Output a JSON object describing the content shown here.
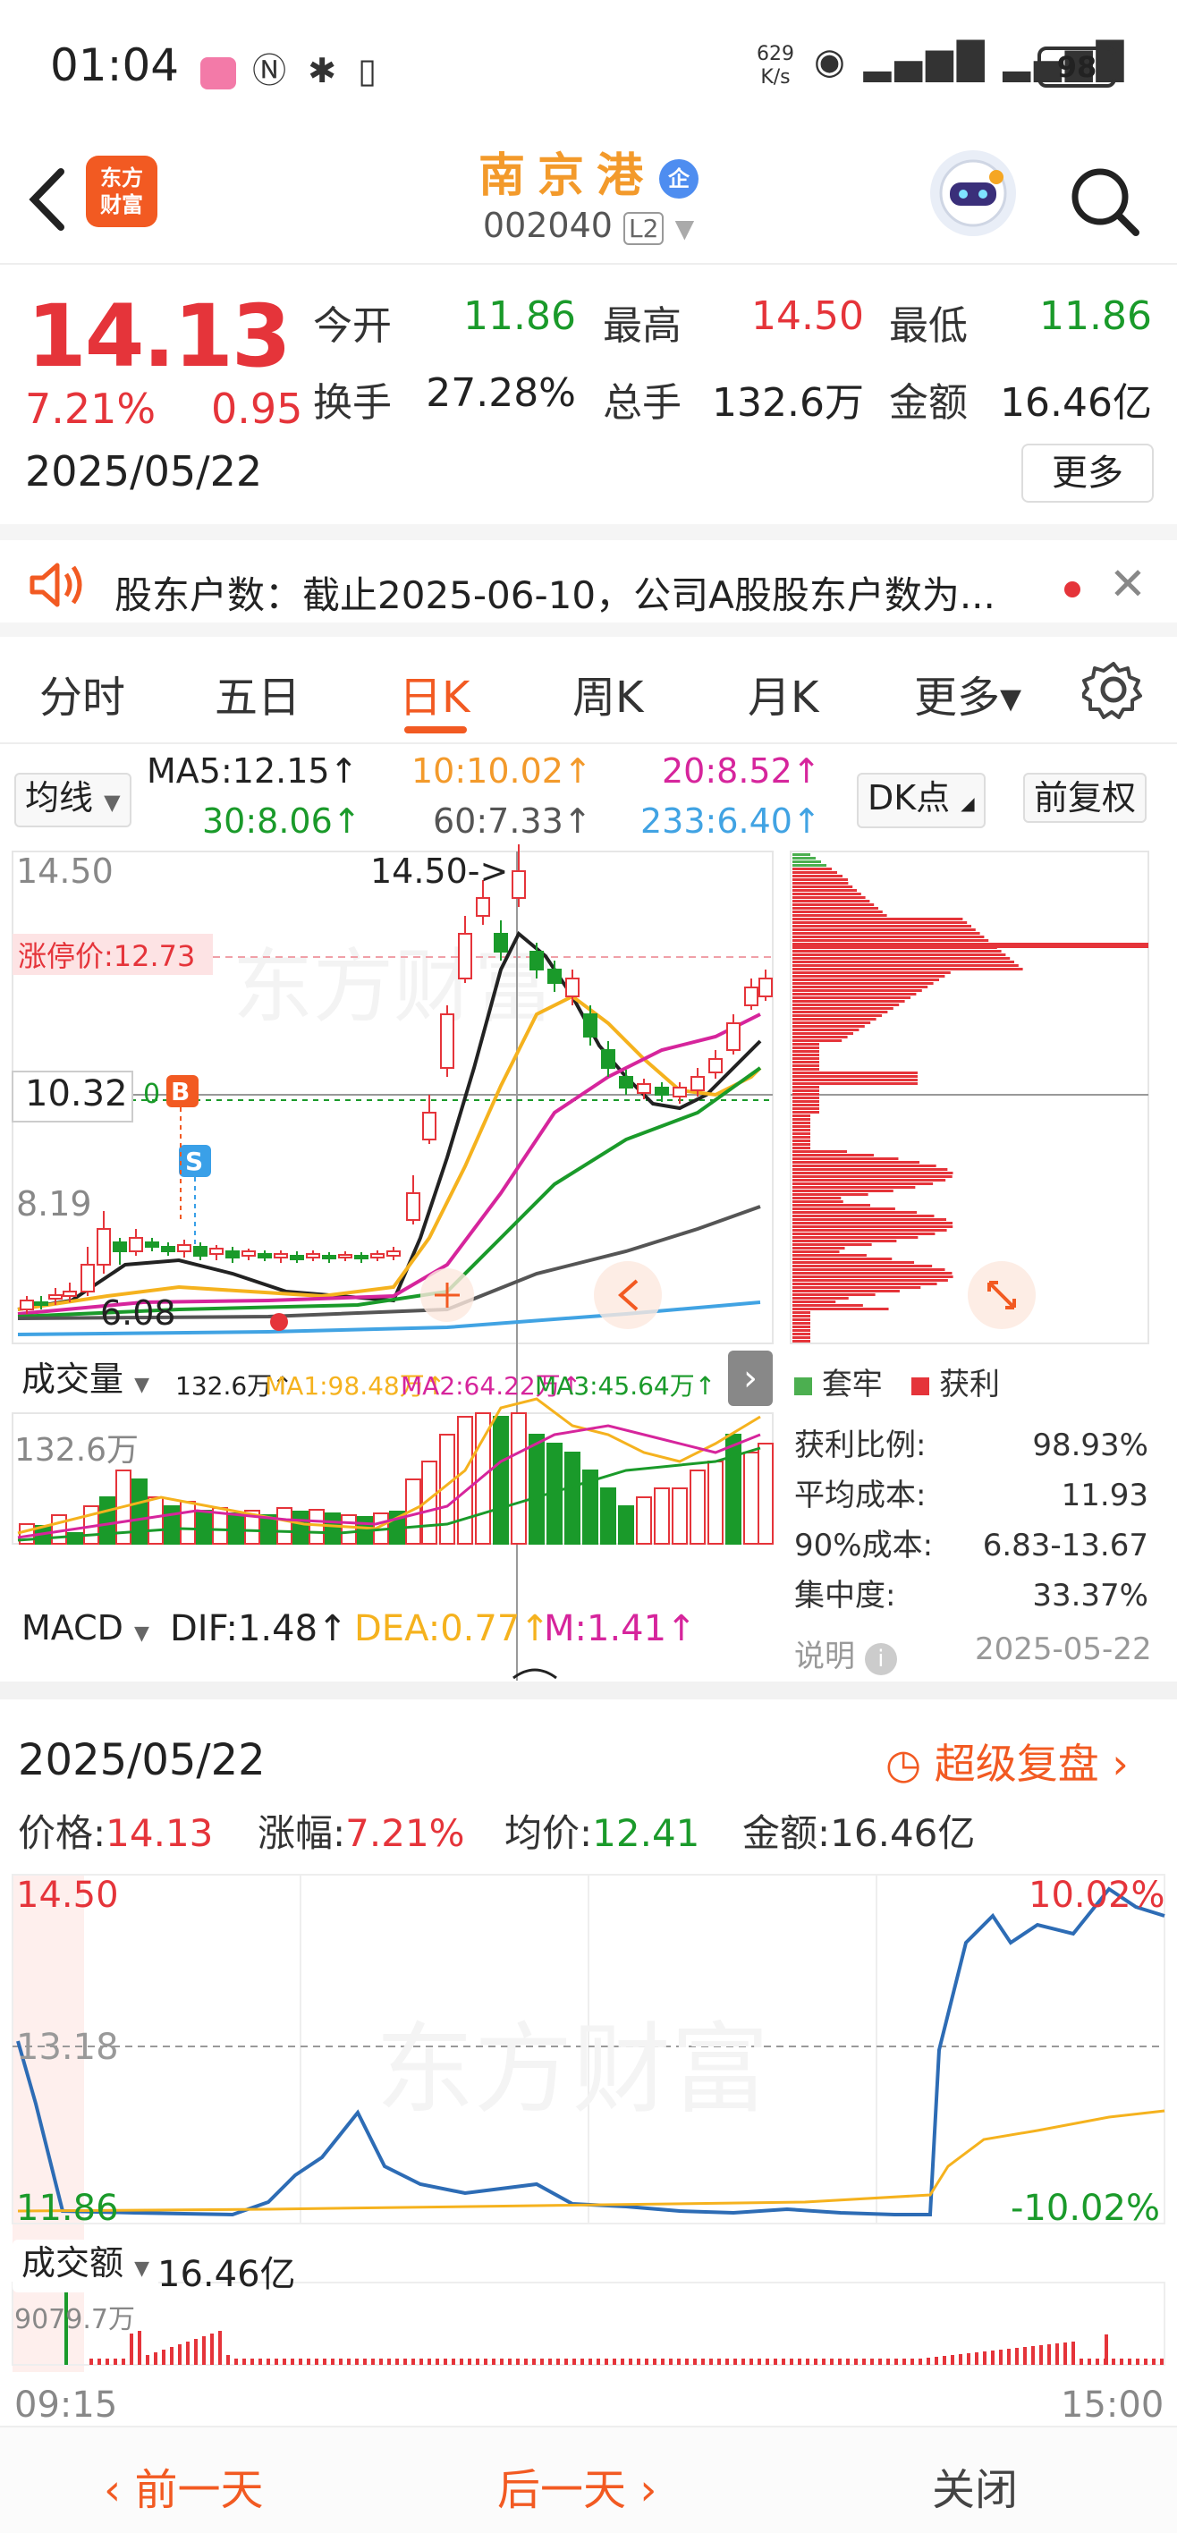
{
  "status_bar": {
    "time": "01:04",
    "net_speed_value": "629",
    "net_speed_unit": "K/s",
    "battery": "98"
  },
  "header": {
    "logo_line1": "东方",
    "logo_line2": "财富",
    "stock_name": "南京港",
    "badge": "企",
    "stock_code": "002040",
    "level": "L2"
  },
  "quote": {
    "price": "14.13",
    "change_pct": "7.21%",
    "change": "0.95",
    "date": "2025/05/22",
    "open_label": "今开",
    "open": "11.86",
    "high_label": "最高",
    "high": "14.50",
    "low_label": "最低",
    "low": "11.86",
    "turnover_label": "换手",
    "turnover": "27.28%",
    "volume_label": "总手",
    "volume": "132.6万",
    "amount_label": "金额",
    "amount": "16.46亿",
    "more": "更多"
  },
  "notice": {
    "text": "股东户数：截止2025-06-10，公司A股股东户数为..."
  },
  "tabs": [
    "分时",
    "五日",
    "日K",
    "周K",
    "月K",
    "更多▾"
  ],
  "ma_row": {
    "selector": "均线",
    "ma5": "MA5:12.15↑",
    "ma10": "10:10.02↑",
    "ma20": "20:8.52↑",
    "ma30": "30:8.06↑",
    "ma60": "60:7.33↑",
    "ma233": "233:6.40↑",
    "dk": "DK点",
    "fq": "前复权"
  },
  "kline": {
    "y_top": "14.50",
    "limit_up": "涨停价:12.73",
    "y_mid": "10.32",
    "y_low": "8.19",
    "low_mark": "6.08",
    "high_mark": "14.50->",
    "b_marker": "B",
    "s_marker": "S",
    "zero_label": "0"
  },
  "volume_panel": {
    "selector": "成交量",
    "vol": "132.6万↑",
    "ma1": "MA1:98.48万↑",
    "ma2": "MA2:64.22万↑",
    "ma3": "MA3:45.64万↑",
    "y_top": "132.6万"
  },
  "macd": {
    "selector": "MACD",
    "dif": "DIF:1.48↑",
    "dea": "DEA:0.77↑",
    "m": "M:1.41↑"
  },
  "chips": {
    "legend_trapped": "套牢",
    "legend_profit": "获利",
    "rows": [
      {
        "label": "获利比例:",
        "value": "98.93%"
      },
      {
        "label": "平均成本:",
        "value": "11.93"
      },
      {
        "label": "90%成本:",
        "value": "6.83-13.67"
      },
      {
        "label": "集中度:",
        "value": "33.37%"
      }
    ],
    "explain": "说明",
    "date": "2025-05-22"
  },
  "detail": {
    "date": "2025/05/22",
    "replay": "超级复盘",
    "price_label": "价格:",
    "price": "14.13",
    "pct_label": "涨幅:",
    "pct": "7.21%",
    "avg_label": "均价:",
    "avg": "12.41",
    "amt_label": "金额:",
    "amt": "16.46亿",
    "y_top": "14.50",
    "y_mid": "13.18",
    "y_low": "11.86",
    "pct_top": "10.02%",
    "pct_low": "-10.02%",
    "amount_selector": "成交额",
    "amount_total": "16.46亿",
    "amount_peak": "9079.7万",
    "t_start": "09:15",
    "t_end": "15:00",
    "watermark": "东方财富"
  },
  "footer": {
    "prev": "前一天",
    "next": "后一天",
    "close": "关闭"
  },
  "colors": {
    "up": "#e5343a",
    "down": "#1a9a2a",
    "accent": "#f25a22"
  }
}
